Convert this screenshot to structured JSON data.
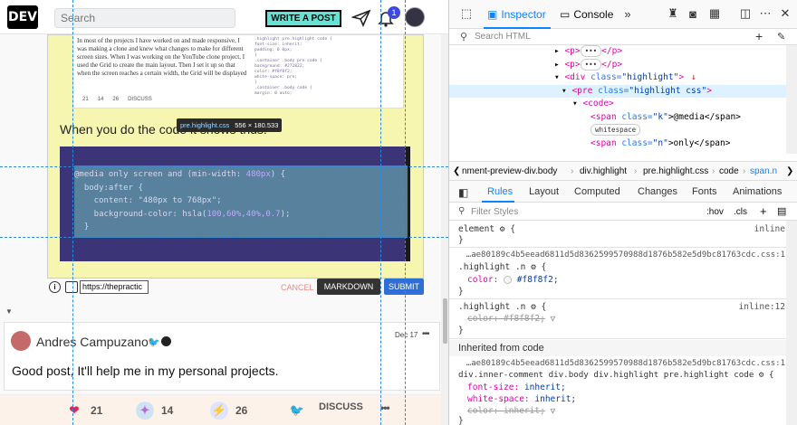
{
  "site": {
    "logo": "DEV",
    "search_placeholder": "Search",
    "write_post": "WRITE A POST",
    "notification_count": "1"
  },
  "preview": {
    "thumb_text": "In most of the projects I have worked on and made responsive, I was making a clone and knew what changes to make for different screen sizes. When I was working on the YouTube clone project, I used the Grid to create the main layout. Then I set it up so that when the screen reaches a certain width, the Grid will be displayed",
    "thumb_counts": [
      "21",
      "14",
      "26",
      "DISCUSS"
    ],
    "tooltip_selector": "pre.highlight.css",
    "tooltip_size": "556 × 180.533",
    "line": "When you do the code it shows thus:",
    "code": {
      "line1_a": "@media only screen and (min-width: ",
      "line1_num": "480px",
      "line1_b": ") {",
      "line2": "  body:after {",
      "line3": "    content: \"480px to 768px\";",
      "line4_a": "    background-color: hsla(",
      "line4_num": "100,60%,40%,0.7",
      "line4_b": ");",
      "line5": "  }"
    }
  },
  "comment_form": {
    "info": "i",
    "url_value": "https://thepractic",
    "cancel": "CANCEL",
    "markdown": "MARKDOWN",
    "submit": "SUBMIT"
  },
  "comment": {
    "author": "Andres Campuzano",
    "date": "Dec 17",
    "body": "Good post, It'll help me in my personal projects."
  },
  "actions": {
    "hearts": "21",
    "unicorns": "14",
    "saves": "26",
    "discuss": "DISCUSS"
  },
  "devtools": {
    "tabs": [
      "Inspector",
      "Console"
    ],
    "search_placeholder": "Search HTML",
    "markup": {
      "r1": "<p>",
      "r1_end": "</p>",
      "r2": "<p>",
      "r2_end": "</p>",
      "r3_tag": "<div ",
      "r3_attr": "class=",
      "r3_val": "\"highlight\"",
      "r3_end": ">",
      "r4_tag": "<pre ",
      "r4_attr": "class=",
      "r4_val": "\"highlight css\"",
      "r4_end": ">",
      "r5": "<code>",
      "r6_tag": "<span ",
      "r6_attr": "class=",
      "r6_val": "\"k\"",
      "r6_text": ">@media</span>",
      "r7_pill": "whitespace",
      "r8_tag": "<span ",
      "r8_attr": "class=",
      "r8_val": "\"n\"",
      "r8_text": ">only</span>"
    },
    "breadcrumb": [
      "nment-preview-div.body",
      "div.highlight",
      "pre.highlight.css",
      "code",
      "span.n"
    ],
    "rule_tabs": [
      "Rules",
      "Layout",
      "Computed",
      "Changes",
      "Fonts",
      "Animations"
    ],
    "filter_placeholder": "Filter Styles",
    "filter_hov": ":hov",
    "filter_cls": ".cls",
    "rules": {
      "element": "element",
      "inline": "inline",
      "file1": "…ae80189c4b5eead6811d5d8362599570988d1876b582e5d9bc81763cdc.css:1",
      "sel1": ".highlight .n",
      "p1": "color:",
      "v1": "#f8f8f2;",
      "sel2": ".highlight .n",
      "inline12": "inline:12",
      "p2": "color: #f8f8f2;",
      "inherited": "Inherited from code",
      "file2": "…ae80189c4b5eead6811d5d8362599570988d1876b582e5d9bc81763cdc.css:1",
      "sel3": "div.inner-comment div.body div.highlight pre.highlight code",
      "p3": "font-size:",
      "v3": "inherit;",
      "p4": "white-space:",
      "v4": "inherit;",
      "p5": "color: inherit;"
    }
  }
}
